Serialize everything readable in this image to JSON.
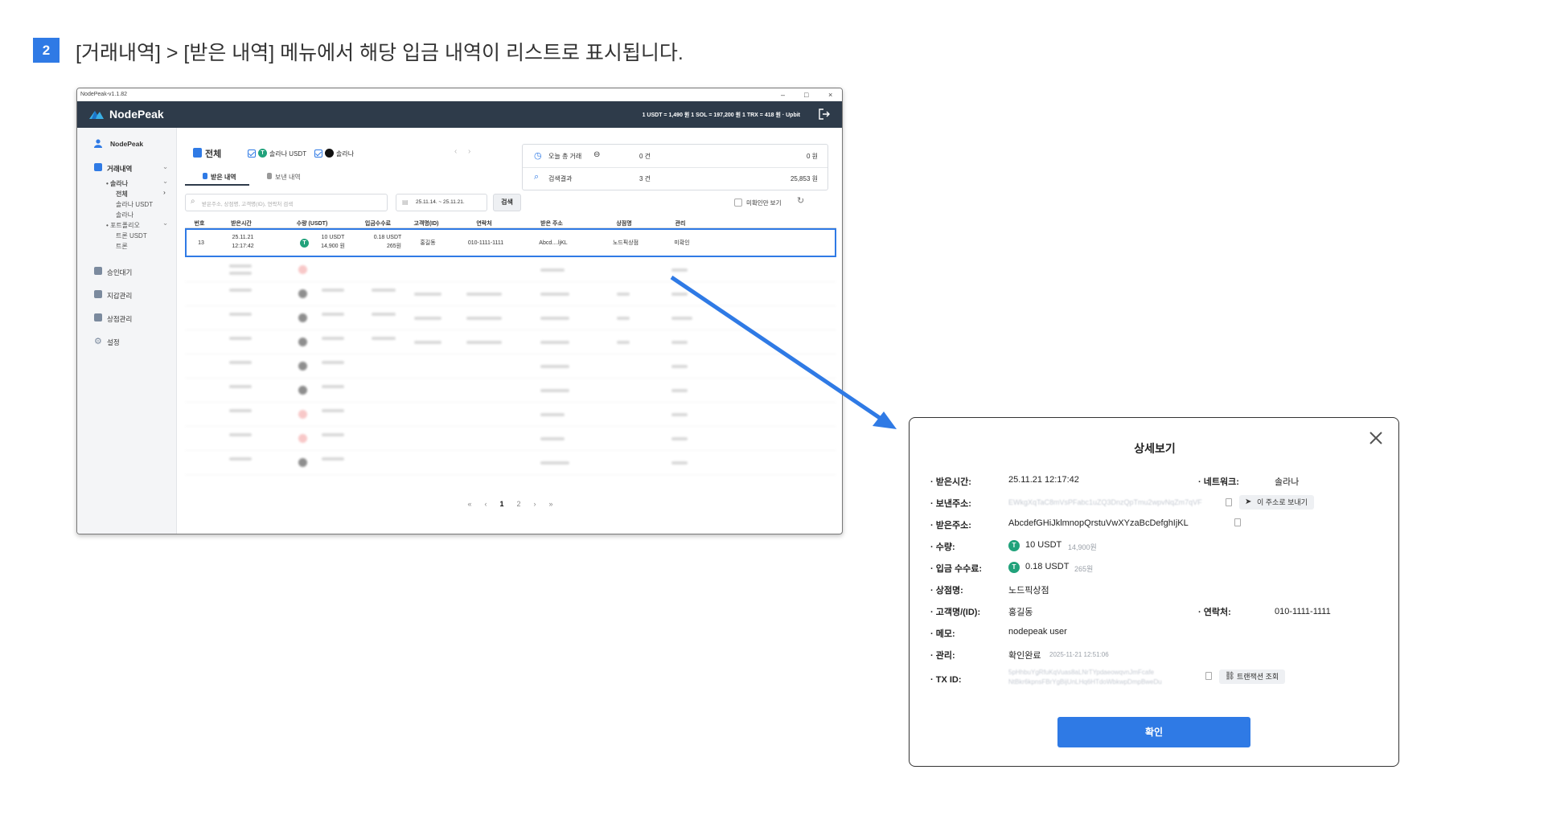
{
  "step": {
    "number": "2",
    "title": "[거래내역] > [받은 내역] 메뉴에서 해당 입금 내역이 리스트로 표시됩니다."
  },
  "window": {
    "title": "NodePeak-v1.1.82",
    "controls": {
      "minimize": "–",
      "maximize": "□",
      "close": "×"
    },
    "app_name": "NodePeak",
    "rates": "1 USDT = 1,490 원    1 SOL = 197,200 원    1 TRX = 418 원    · Upbit",
    "colors": {
      "header": "#2e3b4a",
      "accent": "#2f7ae5",
      "tether": "#21a27b"
    }
  },
  "sidebar": {
    "user": "NodePeak",
    "items": [
      {
        "label": "거래내역",
        "icon": "list-icon"
      },
      {
        "label": "승인대기",
        "icon": "clock-icon"
      },
      {
        "label": "지갑관리",
        "icon": "wallet-icon"
      },
      {
        "label": "상점관리",
        "icon": "store-icon"
      },
      {
        "label": "설정",
        "icon": "gear-icon"
      }
    ],
    "sub": {
      "solana": "• 솔라나",
      "all": "전체",
      "solana_usdt": "솔라나 USDT",
      "solana_coin": "솔라나",
      "portfolio": "• 포트폴리오",
      "tron_usdt": "트론 USDT",
      "tron": "트론"
    }
  },
  "main": {
    "header_title": "전체",
    "filter1": "솔라나 USDT",
    "filter2": "솔라나",
    "tabs": {
      "received": "받은 내역",
      "sent": "보낸 내역"
    },
    "stats": {
      "today_label": "오늘 총 거래",
      "today_count": "0 건",
      "today_amount": "0 원",
      "result_label": "검색결과",
      "result_count": "3 건",
      "result_amount": "25,853 원"
    },
    "search_placeholder": "받은주소, 상점명, 고객명(ID), 연락처 검색",
    "date_range": "25.11.14. ~ 25.11.21.",
    "search_button": "검색",
    "unconfirmed_label": "미확인만 보기",
    "columns": [
      "번호",
      "받은시간",
      "수량 (USDT)",
      "입금수수료",
      "고객명(ID)",
      "연락처",
      "받은 주소",
      "상점명",
      "관리"
    ],
    "row": {
      "no": "13",
      "date": "25.11.21",
      "time": "12:17:42",
      "amount": "10 USDT",
      "amount_krw": "14,900 원",
      "fee": "0.18 USDT",
      "fee_krw": "265원",
      "customer": "홍길동",
      "phone": "010-1111-1111",
      "address": "Abcd....ljKL",
      "store": "노드픽상점",
      "status": "미확인"
    },
    "pagination": {
      "first": "«",
      "prev": "‹",
      "page1": "1",
      "page2": "2",
      "next": "›",
      "last": "»"
    }
  },
  "modal": {
    "title": "상세보기",
    "labels": {
      "received_time": "· 받은시간:",
      "network": "· 네트워크:",
      "sender": "· 보낸주소:",
      "receiver": "· 받은주소:",
      "amount": "· 수량:",
      "fee": "· 입금 수수료:",
      "store": "· 상점명:",
      "customer": "· 고객명/(ID):",
      "phone": "· 연락처:",
      "memo": "· 메모:",
      "manage": "· 관리:",
      "txid": "· TX ID:"
    },
    "values": {
      "received_time": "25.11.21 12:17:42",
      "network": "솔라나",
      "sender": "EWkgXqTaC8mVsPFabc1uZQ3DnzQpTmu2wpvNqZm7qVF",
      "send_to_button": "이 주소로 보내기",
      "receiver": "AbcdefGHiJklmnopQrstuVwXYzaBcDefghIjKL",
      "amount": "10 USDT",
      "amount_krw": "14,900원",
      "fee": "0.18 USDT",
      "fee_krw": "265원",
      "store": "노드픽상점",
      "customer": "홍길동",
      "phone": "010-1111-1111",
      "memo": "nodepeak user",
      "manage": "확인완료",
      "manage_time": "2025-11-21 12:51:06",
      "txid_line1": "5pHhbuYgRfuKqVuas8aLNrTYpdaeowqvnJmFcafe",
      "txid_line2": "NtBkr6kpnsFBrYgBijUnLHq6HTdoWbkwpDmpBweDu",
      "tx_button": "트랜잭션 조회",
      "confirm": "확인"
    }
  }
}
